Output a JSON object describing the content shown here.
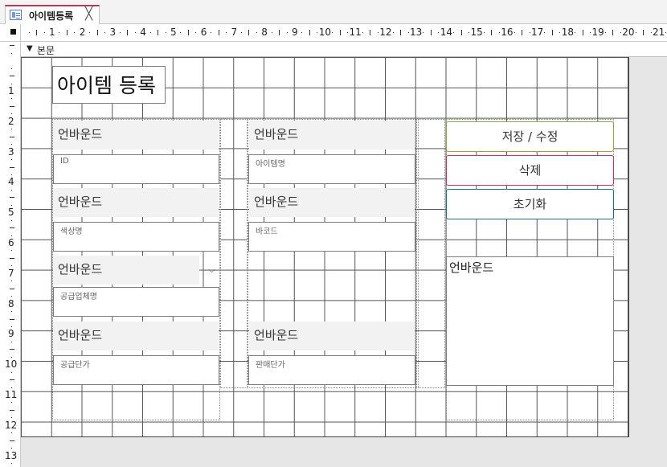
{
  "tab": {
    "title": "아이템등록",
    "close": "╳"
  },
  "section": {
    "label": "본문",
    "arrow": "▼"
  },
  "form": {
    "title": "아이템 등록",
    "unbound_text": "언바운드",
    "fields": {
      "id": "ID",
      "item_name": "아이템명",
      "color_name": "색상명",
      "barcode": "바코드",
      "supplier_name": "공급업체명",
      "supply_price": "공급단가",
      "sale_price": "판매단가"
    },
    "combo_arrow": "⌵",
    "memo_text": "언바운드"
  },
  "buttons": {
    "save": "저장 / 수정",
    "delete": "삭제",
    "reset": "초기화"
  },
  "ruler": {
    "horizontal": [
      "1",
      "2",
      "3",
      "4",
      "5",
      "6",
      "7",
      "8",
      "9",
      "10",
      "11",
      "12",
      "13",
      "14",
      "15",
      "16",
      "17",
      "18",
      "19",
      "20",
      "21"
    ],
    "vertical": [
      "1",
      "2",
      "3",
      "4",
      "5",
      "6",
      "7",
      "8",
      "9",
      "10",
      "11",
      "12",
      "13"
    ]
  },
  "colors": {
    "tab_accent": "#b3395b",
    "save_border": "#8aa64f",
    "delete_border": "#b33b57",
    "reset_border": "#2a6e73"
  }
}
